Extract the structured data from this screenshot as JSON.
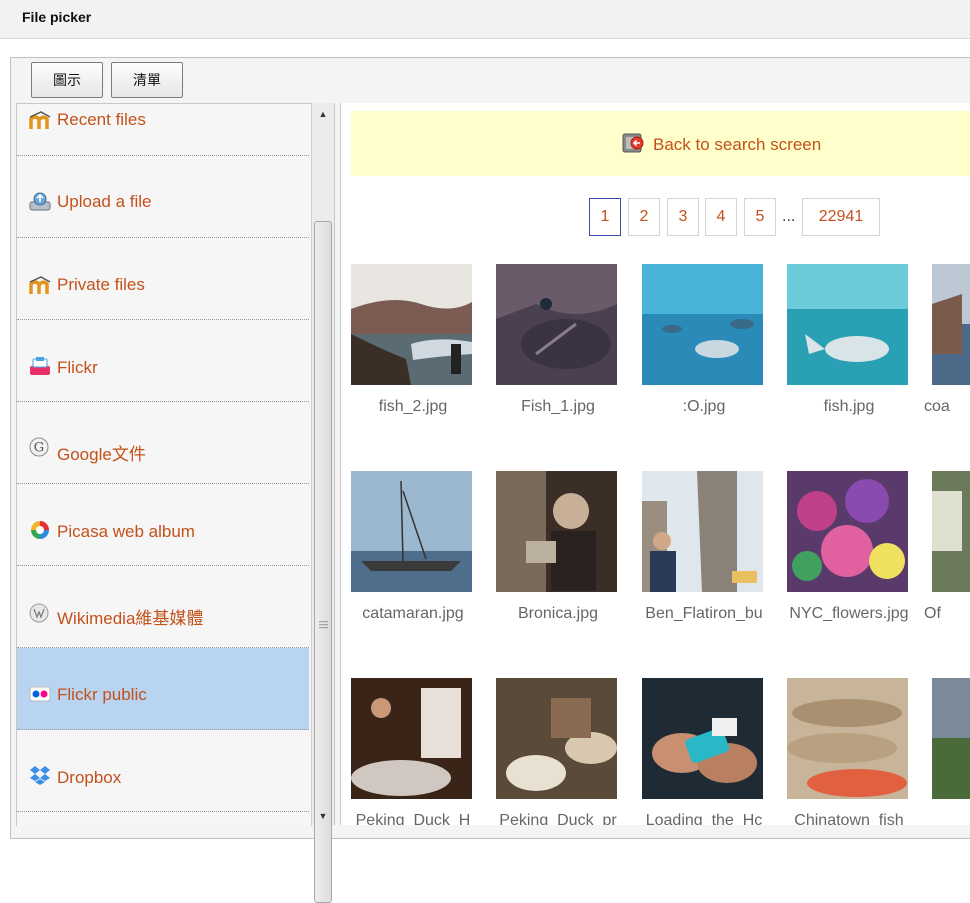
{
  "window": {
    "title": "File picker"
  },
  "view_buttons": {
    "icons_label": "圖示",
    "list_label": "清單"
  },
  "repositories": [
    {
      "label": "Recent files",
      "icon": "moodle-icon",
      "selected": false
    },
    {
      "label": "Upload a file",
      "icon": "upload-icon",
      "selected": false
    },
    {
      "label": "Private files",
      "icon": "moodle-icon",
      "selected": false
    },
    {
      "label": "Flickr",
      "icon": "flickr-icon",
      "selected": false
    },
    {
      "label": "Google文件",
      "icon": "google-icon",
      "selected": false
    },
    {
      "label": "Picasa web album",
      "icon": "picasa-icon",
      "selected": false
    },
    {
      "label": "Wikimedia維基媒體",
      "icon": "wikimedia-icon",
      "selected": false
    },
    {
      "label": "Flickr public",
      "icon": "flickr-public-icon",
      "selected": true
    },
    {
      "label": "Dropbox",
      "icon": "dropbox-icon",
      "selected": false
    }
  ],
  "back": {
    "label": "Back to search screen"
  },
  "pagination": {
    "pages": [
      "1",
      "2",
      "3",
      "4",
      "5"
    ],
    "current": "1",
    "ellipsis": "...",
    "last": "22941"
  },
  "files": [
    {
      "name": "fish_2.jpg"
    },
    {
      "name": "Fish_1.jpg"
    },
    {
      "name": ":O.jpg"
    },
    {
      "name": "fish.jpg"
    },
    {
      "name": "coa"
    },
    {
      "name": "catamaran.jpg"
    },
    {
      "name": "Bronica.jpg"
    },
    {
      "name": "Ben_Flatiron_bu"
    },
    {
      "name": "NYC_flowers.jpg"
    },
    {
      "name": "Of"
    },
    {
      "name": "Peking_Duck_H"
    },
    {
      "name": "Peking_Duck_pr"
    },
    {
      "name": "Loading_the_Hc"
    },
    {
      "name": "Chinatown_fish"
    },
    {
      "name": ""
    }
  ],
  "colors": {
    "link": "#c4511a",
    "selected_row": "#b8d4f0",
    "back_bar": "#ffffcc"
  }
}
